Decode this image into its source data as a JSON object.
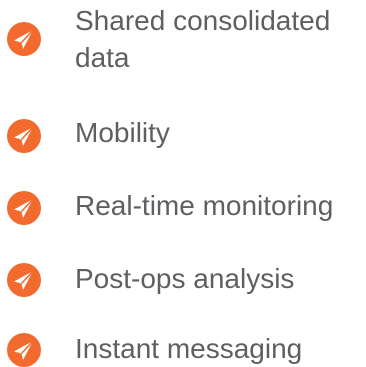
{
  "accent_color": "#f26a2e",
  "check_icon": "paper-plane-check-icon",
  "features": [
    {
      "lines": [
        "Shared consolidated",
        "data"
      ]
    },
    {
      "lines": [
        "Mobility"
      ]
    },
    {
      "lines": [
        "Real-time monitoring"
      ]
    },
    {
      "lines": [
        "Post-ops analysis"
      ]
    },
    {
      "lines": [
        "Instant messaging"
      ]
    }
  ]
}
